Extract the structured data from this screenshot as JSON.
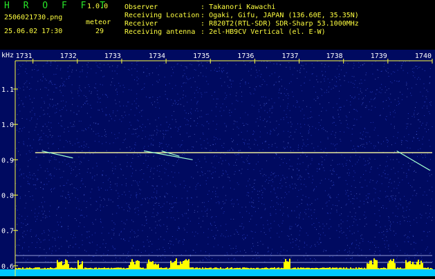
{
  "header": {
    "app_name": "H R O F F T",
    "version": "1.0.0",
    "filename": "2506021730.png",
    "datetime": "25.06.02 17:30",
    "meteor_label": "meteor",
    "meteor_count": "29",
    "info": [
      {
        "key": "Observer",
        "sep": ":",
        "value": "Takanori Kawachi"
      },
      {
        "key": "Receiving Location",
        "sep": ":",
        "value": "Ogaki, Gifu, JAPAN (136.60E, 35.35N)"
      },
      {
        "key": "Receiver",
        "sep": ":",
        "value": "R820T2(RTL-SDR) SDR-Sharp 53.1000MHz"
      },
      {
        "key": "Receiving antenna",
        "sep": ":",
        "value": "2el-HB9CV Vertical (el. E-W)"
      }
    ]
  },
  "chart_data": {
    "type": "heatmap",
    "ylabel": "kHz",
    "x_ticks": [
      "1731",
      "1732",
      "1733",
      "1734",
      "1735",
      "1736",
      "1737",
      "1738",
      "1739",
      "1740"
    ],
    "x_range": [
      1730.6,
      1740.0
    ],
    "y_ticks": [
      "1.1",
      "1.0",
      "0.9",
      "0.8",
      "0.7",
      "0.6"
    ],
    "y_range": [
      0.59,
      1.18
    ],
    "carrier_khz": 0.92,
    "carrier_start": 1731.05,
    "meteor_echoes": [
      {
        "x1": 1731.2,
        "y1": 0.925,
        "x2": 1731.9,
        "y2": 0.905
      },
      {
        "x1": 1733.5,
        "y1": 0.925,
        "x2": 1734.6,
        "y2": 0.9
      },
      {
        "x1": 1733.9,
        "y1": 0.925,
        "x2": 1734.3,
        "y2": 0.91
      },
      {
        "x1": 1739.2,
        "y1": 0.925,
        "x2": 1739.95,
        "y2": 0.87
      }
    ],
    "colors": {
      "background": "#000a60",
      "noise": "#3f5fff",
      "signal": "#ffffa0",
      "axis": "#ffff40",
      "tick_text": "#ffffff",
      "bar_cyan": "#00c8ff",
      "bar_yellow": "#ffff00"
    }
  }
}
